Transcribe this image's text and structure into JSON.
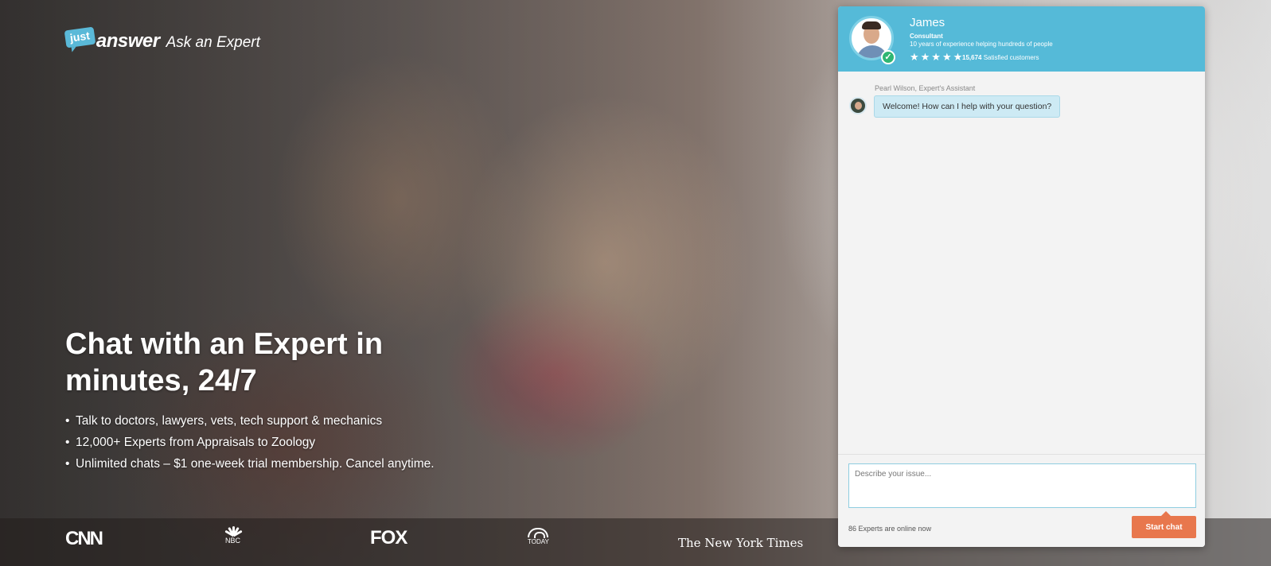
{
  "logo": {
    "bubble": "just",
    "word": "answer",
    "tagline": "Ask an Expert"
  },
  "hero": {
    "headline": "Chat with an Expert in minutes, 24/7",
    "bullets": [
      "Talk to doctors, lawyers, vets, tech support & mechanics",
      "12,000+ Experts from Appraisals to Zoology",
      "Unlimited chats – $1 one-week trial membership. Cancel anytime."
    ]
  },
  "press": {
    "cnn": "CNN",
    "nbc": "NBC",
    "fox": "FOX",
    "today": "TODAY",
    "nyt": "The New York Times"
  },
  "chat": {
    "expert": {
      "name": "James",
      "title": "Consultant",
      "experience": "10 years of experience helping hundreds of people",
      "stars": "★★★★★",
      "rating": 5,
      "satisfied_count": "15,674",
      "satisfied_label": "Satisfied customers"
    },
    "message": {
      "sender": "Pearl Wilson, Expert's Assistant",
      "text": "Welcome! How can I help with your question?"
    },
    "input_placeholder": "Describe your issue...",
    "online_text": "86 Experts are online now",
    "start_label": "Start chat"
  },
  "colors": {
    "header": "#55bad8",
    "start_button": "#e8774d",
    "bubble": "#cdeaf4",
    "verified": "#2fb673"
  }
}
